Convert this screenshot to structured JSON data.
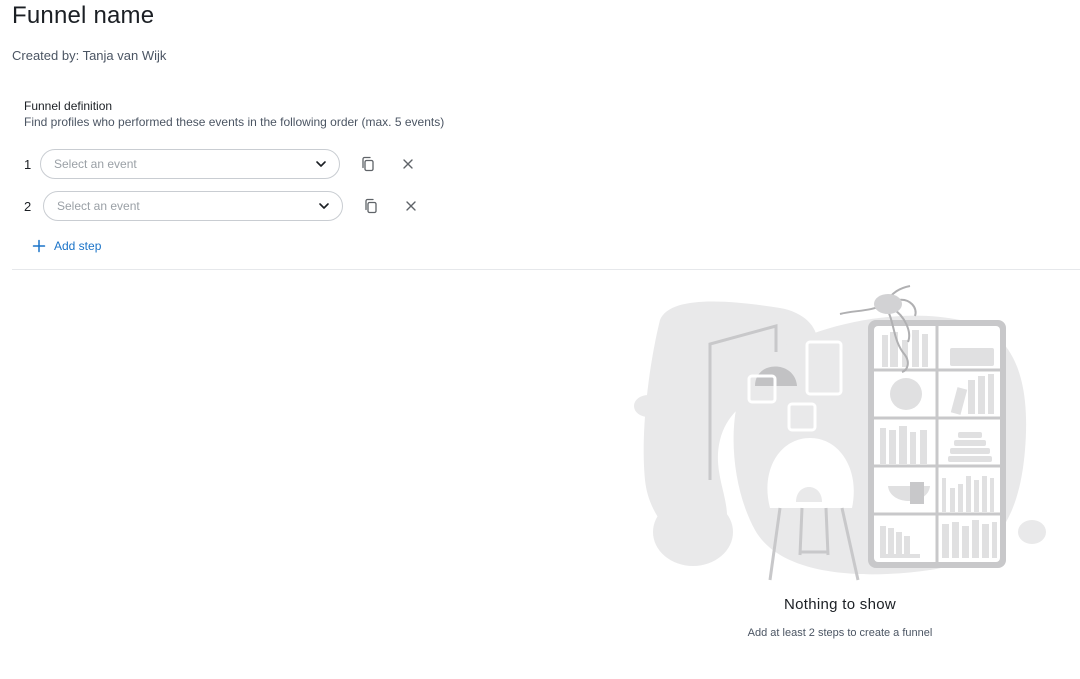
{
  "header": {
    "title": "Funnel name",
    "created_by": "Created by: Tanja van Wijk"
  },
  "definition": {
    "title": "Funnel definition",
    "subtitle": "Find profiles who performed these events in the following order (max. 5 events)"
  },
  "steps": [
    {
      "number": "1",
      "placeholder": "Select an event"
    },
    {
      "number": "2",
      "placeholder": "Select an event"
    }
  ],
  "actions": {
    "add_step_label": "Add step"
  },
  "empty_state": {
    "title": "Nothing to show",
    "subtitle": "Add at least 2 steps to create a funnel"
  },
  "colors": {
    "link": "#1a73c8",
    "border": "#c9cdd2",
    "illustration_fill": "#e9e9ea",
    "illustration_stroke": "#c8c8ca"
  },
  "icons": {
    "select_arrow": "chevron-down-icon",
    "duplicate": "copy-icon",
    "remove": "close-icon",
    "add": "plus-icon"
  }
}
